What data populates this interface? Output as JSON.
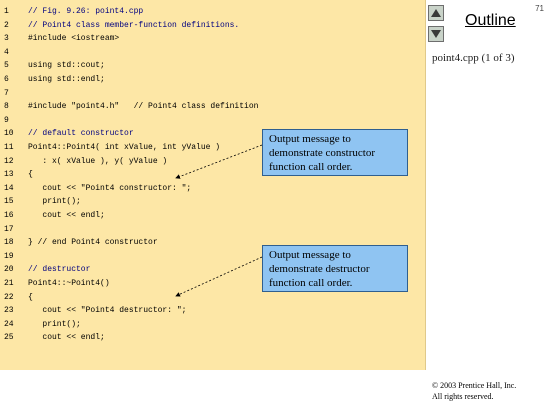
{
  "slide_number": "71",
  "outline": {
    "title": "Outline",
    "item": "point4.cpp (1 of 3)"
  },
  "nav": {
    "up_icon": "triangle-up-icon",
    "down_icon": "triangle-down-icon"
  },
  "code_lines": [
    {
      "n": "1",
      "text": "// Fig. 9.26: point4.cpp",
      "kind": "comment"
    },
    {
      "n": "2",
      "text": "// Point4 class member-function definitions.",
      "kind": "comment"
    },
    {
      "n": "3",
      "text": "#include <iostream>",
      "kind": "code"
    },
    {
      "n": "4",
      "text": "",
      "kind": "code"
    },
    {
      "n": "5",
      "text": "using std::cout;",
      "kind": "code"
    },
    {
      "n": "6",
      "text": "using std::endl;",
      "kind": "code"
    },
    {
      "n": "7",
      "text": "",
      "kind": "code"
    },
    {
      "n": "8",
      "text": "#include \"point4.h\"   // Point4 class definition",
      "kind": "code"
    },
    {
      "n": "9",
      "text": "",
      "kind": "code"
    },
    {
      "n": "10",
      "text": "// default constructor",
      "kind": "comment"
    },
    {
      "n": "11",
      "text": "Point4::Point4( int xValue, int yValue )",
      "kind": "code"
    },
    {
      "n": "12",
      "text": "   : x( xValue ), y( yValue )",
      "kind": "code"
    },
    {
      "n": "13",
      "text": "{",
      "kind": "code"
    },
    {
      "n": "14",
      "text": "   cout << \"Point4 constructor: \";",
      "kind": "code"
    },
    {
      "n": "15",
      "text": "   print();",
      "kind": "code"
    },
    {
      "n": "16",
      "text": "   cout << endl;",
      "kind": "code"
    },
    {
      "n": "17",
      "text": "",
      "kind": "code"
    },
    {
      "n": "18",
      "text": "} // end Point4 constructor",
      "kind": "code"
    },
    {
      "n": "19",
      "text": "",
      "kind": "code"
    },
    {
      "n": "20",
      "text": "// destructor",
      "kind": "comment"
    },
    {
      "n": "21",
      "text": "Point4::~Point4()",
      "kind": "code"
    },
    {
      "n": "22",
      "text": "{",
      "kind": "code"
    },
    {
      "n": "23",
      "text": "   cout << \"Point4 destructor: \";",
      "kind": "code"
    },
    {
      "n": "24",
      "text": "   print();",
      "kind": "code"
    },
    {
      "n": "25",
      "text": "   cout << endl;",
      "kind": "code"
    }
  ],
  "callouts": [
    {
      "lines": [
        "Output message to",
        "demonstrate constructor",
        "function call order."
      ]
    },
    {
      "lines": [
        "Output message to",
        "demonstrate destructor",
        "function call order."
      ]
    }
  ],
  "copyright": [
    "© 2003 Prentice Hall, Inc.",
    "All rights reserved."
  ]
}
